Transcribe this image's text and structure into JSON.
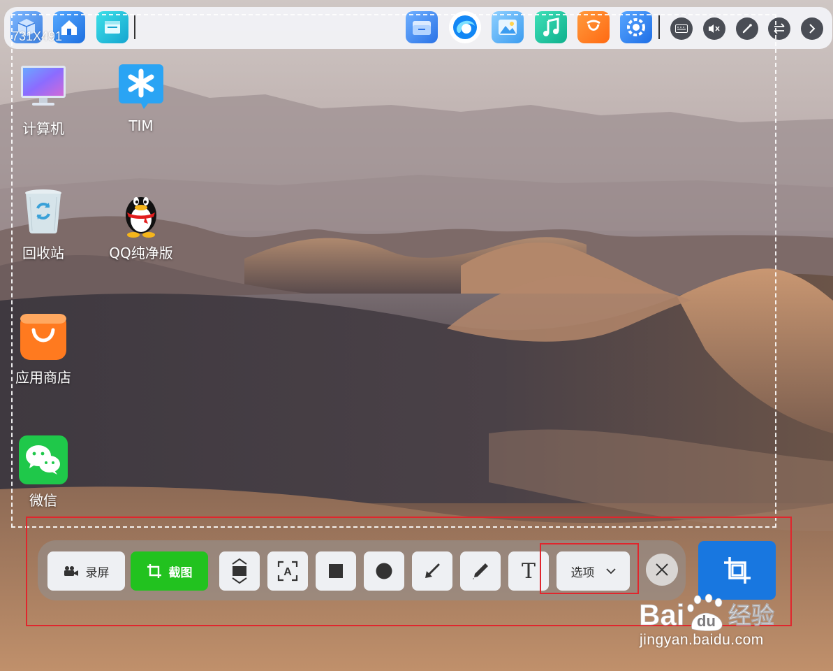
{
  "selection": {
    "size_label": "731X491"
  },
  "top_dock": {
    "apps": [
      {
        "name": "package-icon",
        "color": "#3b8de8"
      },
      {
        "name": "home-icon",
        "color": "#2f8df0"
      },
      {
        "name": "window-icon",
        "color": "#1fb6d9"
      },
      {
        "name": "file-manager-icon",
        "color": "#2f7ff0"
      },
      {
        "name": "browser-icon",
        "color": "#1a9bf0"
      },
      {
        "name": "image-viewer-icon",
        "color": "#36a8f5"
      },
      {
        "name": "music-icon",
        "color": "#18c7a4"
      },
      {
        "name": "app-store-icon",
        "color": "#ff7a1f"
      },
      {
        "name": "settings-icon",
        "color": "#2c86ee"
      }
    ],
    "system_icons": [
      "keyboard-icon",
      "mute-icon",
      "brush-icon",
      "switch-icon",
      "chevron-right-icon"
    ]
  },
  "desktop": {
    "items": [
      {
        "label": "计算机",
        "icon": "computer-icon"
      },
      {
        "label": "TIM",
        "icon": "tim-icon"
      },
      {
        "label": "回收站",
        "icon": "recycle-bin-icon"
      },
      {
        "label": "QQ纯净版",
        "icon": "qq-icon"
      },
      {
        "label": "应用商店",
        "icon": "app-store-icon"
      },
      {
        "label": "微信",
        "icon": "wechat-icon"
      }
    ]
  },
  "toolbar": {
    "record_label": "录屏",
    "screenshot_label": "截图",
    "options_label": "选项",
    "tools": [
      "scroll-capture-icon",
      "ocr-icon",
      "rectangle-icon",
      "circle-icon",
      "arrow-icon",
      "pen-icon",
      "text-icon"
    ],
    "text_tool_glyph": "T",
    "ocr_glyph": "A"
  },
  "watermark": {
    "logo_text": "Bai",
    "logo_du": "du",
    "logo_cn": "经验",
    "url": "jingyan.baidu.com"
  },
  "colors": {
    "screenshot_green": "#22c21f",
    "capture_blue": "#1877e0",
    "annotation_red": "#e0262d"
  }
}
